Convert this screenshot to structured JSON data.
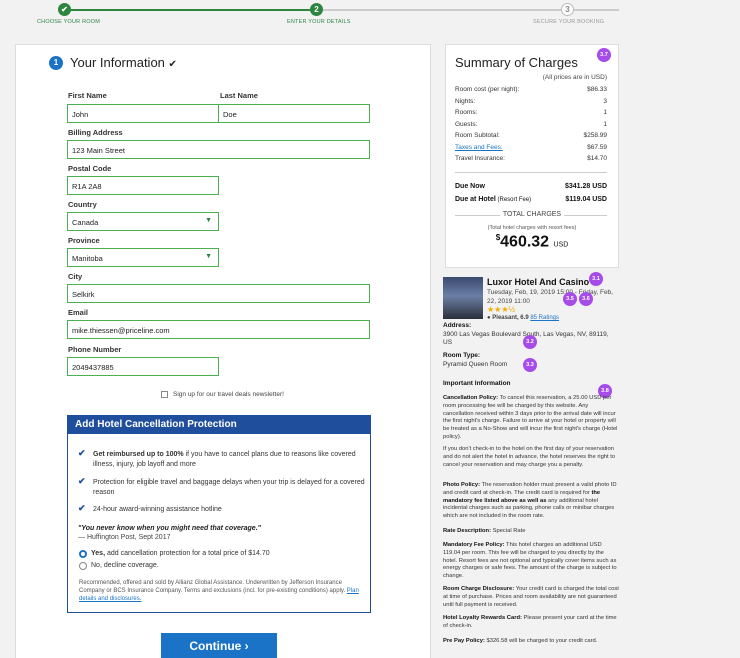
{
  "progress": {
    "steps": [
      {
        "label": "CHOOSE YOUR ROOM",
        "status": "done"
      },
      {
        "label": "ENTER YOUR DETAILS",
        "status": "current",
        "number": "2"
      },
      {
        "label": "SECURE YOUR BOOKING",
        "status": "todo",
        "number": "3"
      }
    ]
  },
  "form": {
    "section_number": "1",
    "title": "Your Information",
    "title_check": "✔",
    "first_name_label": "First Name",
    "first_name_value": "John",
    "last_name_label": "Last Name",
    "last_name_value": "Doe",
    "address_label": "Billing Address",
    "address_value": "123 Main Street",
    "postal_label": "Postal Code",
    "postal_value": "R1A 2A8",
    "country_label": "Country",
    "country_value": "Canada",
    "province_label": "Province",
    "province_value": "Manitoba",
    "city_label": "City",
    "city_value": "Selkirk",
    "email_label": "Email",
    "email_value": "mike.thiessen@priceline.com",
    "phone_label": "Phone Number",
    "phone_value": "2049437885",
    "newsletter_label": "Sign up for our travel deals newsletter!"
  },
  "protection": {
    "heading": "Add Hotel Cancellation Protection",
    "benefit1_bold": "Get reimbursed up to 100%",
    "benefit1_rest": " if you have to cancel plans due to reasons like covered illness, injury, job layoff and more",
    "benefit2": "Protection for eligible travel and baggage delays when your trip is delayed for a covered reason",
    "benefit3": "24-hour award-winning assistance hotline",
    "quote": "\"You never know when you might need that coverage.\"",
    "quote_source": "— Huffington Post, Sept 2017",
    "yes_bold": "Yes,",
    "yes_rest": " add cancellation protection for a total price of $14.70",
    "no_option": "No, decline coverage.",
    "fine_print": "Recommended, offered and sold by Allianz Global Assistance. Underwritten by Jefferson Insurance Company or BCS Insurance Company. Terms and exclusions (incl. for pre-existing conditions) apply.",
    "fine_link": "Plan details and disclosures.",
    "continue_label": "Continue",
    "continue_icon": "›"
  },
  "summary": {
    "title": "Summary of Charges",
    "badge_title": "3.7",
    "note": "(All prices are in USD)",
    "rows": [
      {
        "label": "Room cost (per night):",
        "value": "$86.33"
      },
      {
        "label": "Nights:",
        "value": "3"
      },
      {
        "label": "Rooms:",
        "value": "1"
      },
      {
        "label": "Guests:",
        "value": "1"
      },
      {
        "label": "Room Subtotal:",
        "value": "$258.99"
      },
      {
        "label": "Taxes and Fees:",
        "value": "$67.59"
      },
      {
        "label": "Travel Insurance:",
        "value": "$14.70"
      }
    ],
    "due_now_label": "Due Now",
    "due_now_value": "$341.28 USD",
    "due_hotel_label": "Due at Hotel",
    "due_hotel_note": " (Resort Fee)",
    "due_hotel_value": "$119.04 USD",
    "total_label": "TOTAL CHARGES",
    "total_note": "(Total hotel charges with resort fees)",
    "total_currency_symbol": "$",
    "total_value": "460.32",
    "total_currency": "USD"
  },
  "hotel": {
    "name": "Luxor Hotel And Casino",
    "dates": "Tuesday, Feb, 19, 2019 15:00 - Friday, Feb, 22, 2019 11:00",
    "stars": "★★★½",
    "rating_label": "Pleasant, 6.9",
    "ratings_link": "85 Ratings",
    "address_label": "Address:",
    "address": "3900 Las Vegas Boulevard South, Las Vegas, NV, 89119, US",
    "room_type_label": "Room Type:",
    "room_type": "Pyramid Queen Room",
    "important_label": "Important Information",
    "badges": {
      "name": "3.1",
      "date1": "3.5",
      "date2": "3.6",
      "address": "3.2",
      "room": "3.3",
      "policy": "3.8"
    },
    "cancellation_label": "Cancellation Policy:",
    "cancellation_text": " To cancel this reservation, a 25.00 USD per room processing fee will be charged by this website. Any cancellation received within 3 days prior to the arrival date will incur the first night's charge. Failure to arrive at your hotel or property will be treated as a No-Show and will incur the first night's charge (Hotel policy).",
    "checkin_text": "If you don't check-in to the hotel on the first day of your reservation and do not alert the hotel in advance, the hotel reserves the right to cancel your reservation and may charge you a penalty.",
    "photo_label": "Photo Policy:",
    "photo_text": " The reservation holder must present a valid photo ID and credit card at check-in. The credit card is required for ",
    "photo_bold": "the mandatory fee listed above as well as",
    "photo_text2": " any additional hotel incidental charges such as parking, phone calls or minibar charges which are not included in the room rate.",
    "rate_label": "Rate Description:",
    "rate_text": " Special Rate",
    "mandatory_label": "Mandatory Fee Policy:",
    "mandatory_text": " This hotel charges an additional USD 119.04 per room. This fee will be charged to you directly by the hotel. Resort fees are not optional and typically cover items such as energy charges or safe fees. The amount of the charge is subject to change.",
    "room_charge_label": "Room Charge Disclosure:",
    "room_charge_text": " Your credit card is charged the total cost at time of purchase. Prices and room availability are not guaranteed until full payment is received.",
    "loyalty_label": "Hotel Loyalty Rewards Card:",
    "loyalty_text": " Please present your card at the time of check-in.",
    "prepay_label": "Pre Pay Policy:",
    "prepay_text": " $326.58 will be charged to your credit card."
  },
  "colors": {
    "accent": "#1a73c6",
    "success": "#2e8540",
    "protection": "#1f4e9c",
    "badge": "#a64ce8"
  }
}
